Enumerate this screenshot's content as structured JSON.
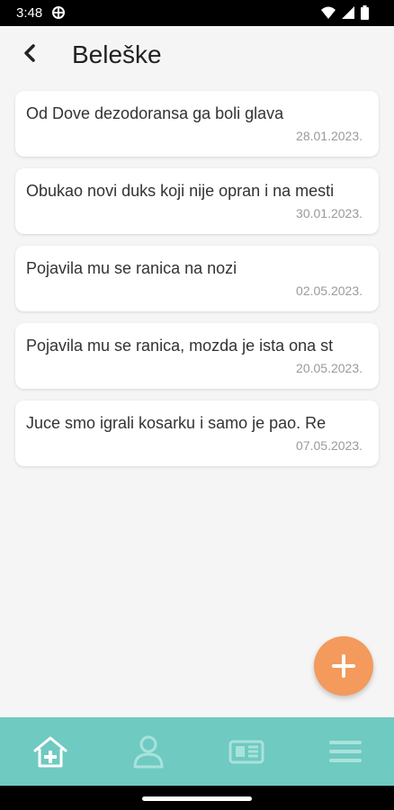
{
  "status_bar": {
    "time": "3:48"
  },
  "header": {
    "title": "Beleške"
  },
  "notes": [
    {
      "text": "Od Dove dezodoransa ga boli glava",
      "date": "28.01.2023."
    },
    {
      "text": "Obukao novi duks koji nije opran i na mesti",
      "date": "30.01.2023."
    },
    {
      "text": "Pojavila mu se ranica na nozi",
      "date": "02.05.2023."
    },
    {
      "text": "Pojavila mu se ranica, mozda je ista ona st",
      "date": "20.05.2023."
    },
    {
      "text": "Juce smo igrali kosarku i samo je pao. Re",
      "date": "07.05.2023."
    }
  ],
  "fab": {
    "icon": "plus-icon",
    "color": "#f39a5c"
  },
  "bottom_nav": {
    "background": "#6fcac1",
    "items": [
      {
        "icon": "home-medical-icon",
        "active": true
      },
      {
        "icon": "profile-icon",
        "active": false
      },
      {
        "icon": "newspaper-icon",
        "active": false
      },
      {
        "icon": "menu-icon",
        "active": false
      }
    ]
  }
}
